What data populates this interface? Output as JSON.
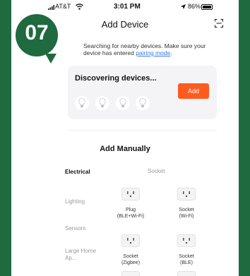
{
  "status_bar": {
    "carrier": "AT&T",
    "time": "3:01 PM",
    "battery": "86%"
  },
  "badge": {
    "number": "07",
    "color": "#1f6a3f"
  },
  "header": {
    "title": "Add Device"
  },
  "search": {
    "text": "Searching for nearby devices. Make sure your device has entered ",
    "link": "pairing mode",
    "suffix": "."
  },
  "discovering": {
    "title": "Discovering devices...",
    "add_label": "Add",
    "accent": "#ff5b1f"
  },
  "manual": {
    "title": "Add Manually",
    "sub_header": "Socket",
    "categories": [
      {
        "label": "Electrical",
        "active": true
      },
      {
        "label": "Lighting",
        "active": false
      },
      {
        "label": "Sensors",
        "active": false
      },
      {
        "label": "Large Home Ap...",
        "active": false
      }
    ],
    "devices": [
      {
        "line1": "Plug",
        "line2": "(BLE+Wi-Fi)"
      },
      {
        "line1": "Socket",
        "line2": "(Wi-Fi)"
      },
      {
        "line1": "Socket",
        "line2": "(Zigbee)"
      },
      {
        "line1": "Socket",
        "line2": "(BLE)"
      }
    ]
  }
}
